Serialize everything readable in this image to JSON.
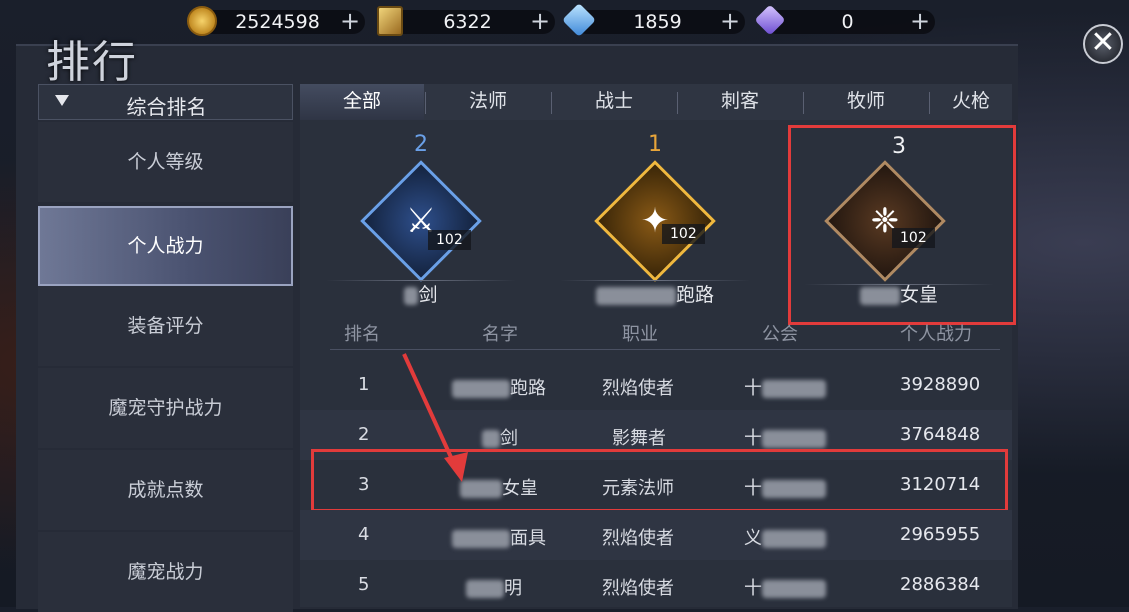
{
  "currency": [
    {
      "icon": "gold-coin-icon",
      "value": "2524598"
    },
    {
      "icon": "card-icon",
      "value": "6322"
    },
    {
      "icon": "blue-crystal-icon",
      "value": "1859"
    },
    {
      "icon": "purple-crystal-icon",
      "value": "0"
    }
  ],
  "currency_plus": "+",
  "title": "排行",
  "close_symbol": "✕",
  "sidebar": {
    "header": "综合排名",
    "items": [
      {
        "label": "个人等级",
        "active": false
      },
      {
        "label": "个人战力",
        "active": true
      },
      {
        "label": "装备评分",
        "active": false
      },
      {
        "label": "魔宠守护战力",
        "active": false
      },
      {
        "label": "成就点数",
        "active": false
      },
      {
        "label": "魔宠战力",
        "active": false
      }
    ]
  },
  "tabs": [
    "全部",
    "法师",
    "战士",
    "刺客",
    "牧师",
    "火枪"
  ],
  "active_tab": "全部",
  "podium": [
    {
      "rank": "2",
      "name_visible": "剑",
      "level": "102",
      "color": "#6aa0e8",
      "icon": "crossed-swords-emblem-icon"
    },
    {
      "rank": "1",
      "name_visible": "跑路",
      "level": "102",
      "color": "#e8a53a",
      "icon": "flame-emblem-icon"
    },
    {
      "rank": "3",
      "name_visible": "女皇",
      "level": "102",
      "color": "#a67a4f",
      "icon": "element-emblem-icon"
    }
  ],
  "table": {
    "headers": [
      "排名",
      "名字",
      "职业",
      "公会",
      "个人战力"
    ],
    "rows": [
      {
        "rank": "1",
        "name": "跑路",
        "class": "烈焰使者",
        "guild": "十",
        "power": "3928890"
      },
      {
        "rank": "2",
        "name": "剑",
        "class": "影舞者",
        "guild": "十",
        "power": "3764848"
      },
      {
        "rank": "3",
        "name": "女皇",
        "class": "元素法师",
        "guild": "十",
        "power": "3120714"
      },
      {
        "rank": "4",
        "name": "面具",
        "class": "烈焰使者",
        "guild": "义",
        "power": "2965955"
      },
      {
        "rank": "5",
        "name": "明",
        "class": "烈焰使者",
        "guild": "十",
        "power": "2886384"
      }
    ]
  },
  "colors": {
    "highlight": "#e23b3b",
    "gold": "#c9a86a"
  }
}
